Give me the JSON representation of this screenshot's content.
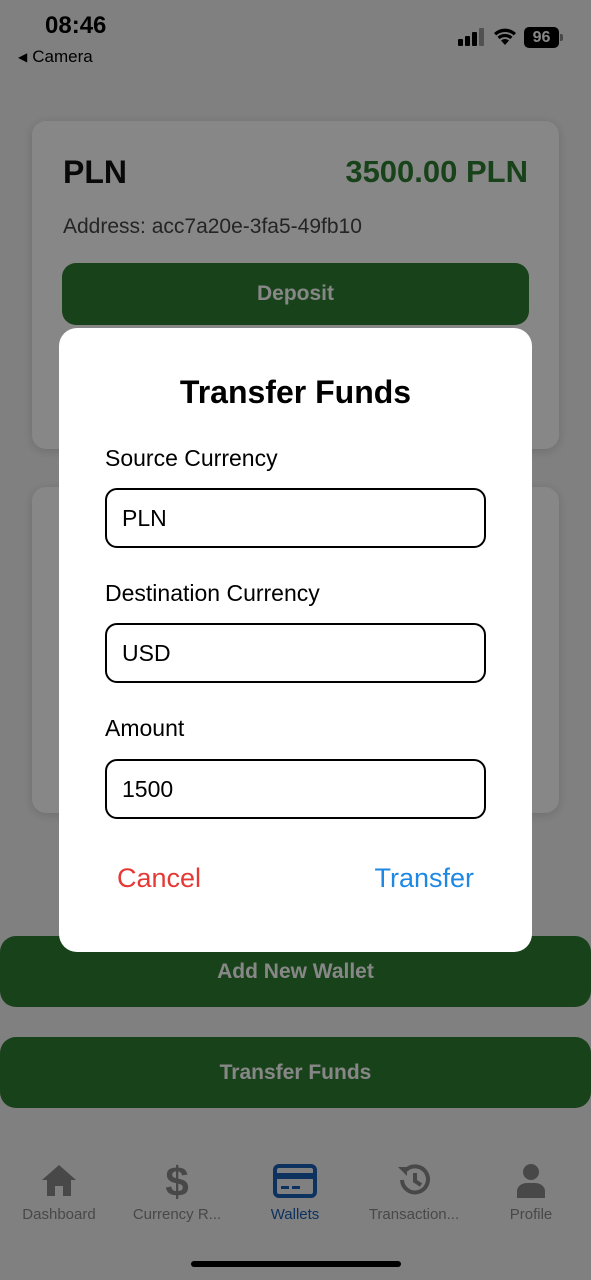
{
  "status_bar": {
    "time": "08:46",
    "back_label": "Camera",
    "battery": "96"
  },
  "wallets": [
    {
      "currency": "PLN",
      "balance": "3500.00 PLN",
      "address": "Address: acc7a20e-3fa5-49fb10",
      "deposit_label": "Deposit"
    }
  ],
  "actions": {
    "add_wallet_label": "Add New Wallet",
    "transfer_funds_label": "Transfer Funds"
  },
  "modal": {
    "title": "Transfer Funds",
    "source_label": "Source Currency",
    "source_value": "PLN",
    "destination_label": "Destination Currency",
    "destination_value": "USD",
    "amount_label": "Amount",
    "amount_value": "1500",
    "cancel_label": "Cancel",
    "transfer_label": "Transfer"
  },
  "tab_bar": {
    "active": "Wallets",
    "items": [
      {
        "label": "Dashboard",
        "icon": "home-icon"
      },
      {
        "label": "Currency R...",
        "icon": "dollar-icon"
      },
      {
        "label": "Wallets",
        "icon": "wallet-card-icon"
      },
      {
        "label": "Transaction...",
        "icon": "history-icon"
      },
      {
        "label": "Profile",
        "icon": "person-icon"
      }
    ]
  },
  "colors": {
    "accent_green": "#2e7d32",
    "tab_active": "#1a5fb4",
    "cancel_red": "#e53935",
    "transfer_blue": "#1e88e5"
  }
}
